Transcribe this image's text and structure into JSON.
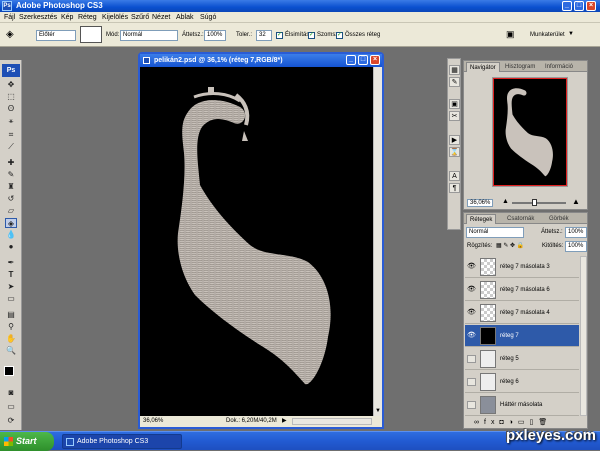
{
  "app": {
    "title": "Adobe Photoshop CS3"
  },
  "menu": [
    "Fájl",
    "Szerkesztés",
    "Kép",
    "Réteg",
    "Kijelölés",
    "Szűrő",
    "Nézet",
    "Ablak",
    "Súgó"
  ],
  "options": {
    "preset_value": "Előtér",
    "mode_label": "Mód:",
    "mode_value": "Normál",
    "opacity_label": "Áttetsz.:",
    "opacity_value": "100%",
    "tolerance_label": "Toler.:",
    "tolerance_value": "32",
    "antialias_label": "Élsimítás",
    "contiguous_label": "Szomsz",
    "all_layers_label": "Összes réteg",
    "workspace_label": "Munkaterület"
  },
  "document": {
    "title": "pelikán2.psd @ 36,1% (réteg 7,RGB/8*)",
    "zoom": "36,06%",
    "doc_size": "Dok.: 6,20M/40,2M"
  },
  "navigator": {
    "tabs": [
      "Navigátor",
      "Hisztogram",
      "Információ"
    ],
    "zoom": "36,06%"
  },
  "layers": {
    "tabs": [
      "Rétegek",
      "Csatornák",
      "Görbék"
    ],
    "blend_mode": "Normál",
    "opacity_label": "Áttetsz.:",
    "opacity_value": "100%",
    "lock_label": "Rögzítés:",
    "fill_label": "Kitöltés:",
    "fill_value": "100%",
    "items": [
      {
        "name": "réteg 7 másolata 3",
        "visible": true,
        "selected": false
      },
      {
        "name": "réteg 7 másolata 6",
        "visible": true,
        "selected": false
      },
      {
        "name": "réteg 7 másolata 4",
        "visible": true,
        "selected": false
      },
      {
        "name": "réteg 7",
        "visible": true,
        "selected": true
      },
      {
        "name": "réteg 5",
        "visible": false,
        "selected": false
      },
      {
        "name": "réteg 6",
        "visible": false,
        "selected": false
      },
      {
        "name": "Háttér másolata",
        "visible": false,
        "selected": false
      }
    ]
  },
  "taskbar": {
    "start": "Start",
    "item": "Adobe Photoshop CS3"
  },
  "watermark": "pxleyes.com",
  "colors": {
    "accent": "#2e5aa9",
    "canvas": "#000000",
    "title_blue": "#0a50d0"
  }
}
